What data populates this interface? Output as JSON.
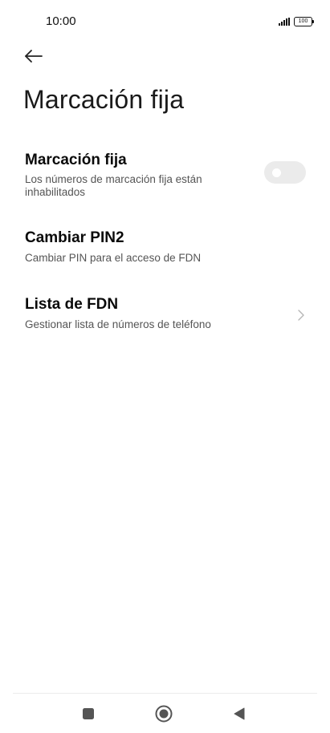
{
  "status_bar": {
    "time": "10:00",
    "battery": "100"
  },
  "header": {
    "back_icon": "arrow-left-icon",
    "title": "Marcación fija"
  },
  "items": [
    {
      "title": "Marcación fija",
      "summary": "Los números de marcación fija están inhabilitados",
      "control": "toggle",
      "toggle_on": false
    },
    {
      "title": "Cambiar PIN2",
      "summary": "Cambiar PIN para el acceso de FDN",
      "control": "none"
    },
    {
      "title": "Lista de FDN",
      "summary": "Gestionar lista de números de teléfono",
      "control": "chevron-right-icon"
    }
  ],
  "nav_bar": {
    "recents_icon": "square-icon",
    "home_icon": "circle-home-icon",
    "back_icon": "triangle-back-icon"
  },
  "colors": {
    "background": "#ffffff",
    "toggle_off_track": "#ebebeb",
    "summary_text": "#555555"
  }
}
